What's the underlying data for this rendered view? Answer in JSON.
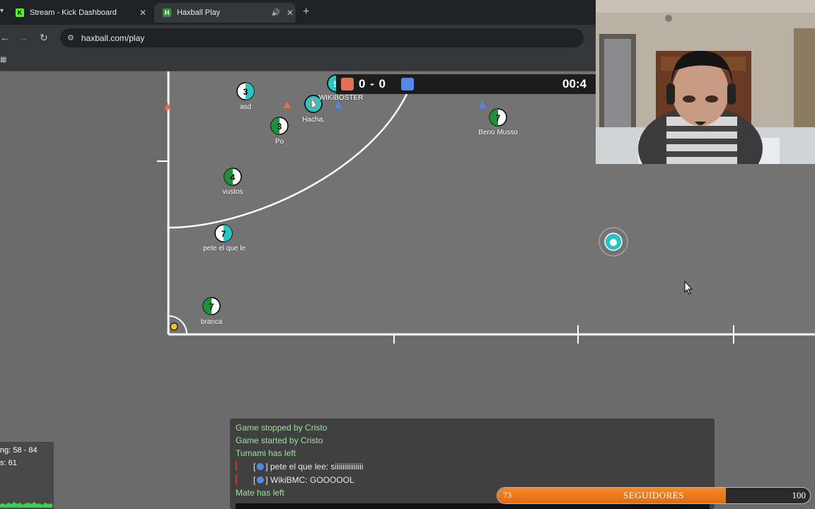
{
  "browser": {
    "tabs": [
      {
        "title": "Stream - Kick Dashboard",
        "icon": "kick-icon",
        "color": "#53fc18"
      },
      {
        "title": "Haxball Play",
        "icon": "haxball-icon",
        "color": "#3a8f3a"
      }
    ],
    "url": "haxball.com/play"
  },
  "scoreboard": {
    "score": "0 - 0",
    "time": "00:4",
    "red_color": "#e56e56",
    "blue_color": "#5689e5"
  },
  "players": [
    {
      "number": "3",
      "name": "asd"
    },
    {
      "number": "3",
      "name": "Po"
    },
    {
      "number": "",
      "name": "Hacha."
    },
    {
      "number": "5",
      "name": "WIKIBOSTER"
    },
    {
      "number": "7",
      "name": "Beno Musso"
    },
    {
      "number": "4",
      "name": "vustos"
    },
    {
      "number": "7",
      "name": "pete el que le"
    },
    {
      "number": "7",
      "name": "branca"
    }
  ],
  "chat": [
    {
      "type": "system",
      "text": "Game stopped by Cristo"
    },
    {
      "type": "system",
      "text": "Game started by Cristo"
    },
    {
      "type": "system",
      "text": "Tumami has left"
    },
    {
      "type": "player",
      "prefix": "[",
      "suffix": "] pete el que lee: siiiiiiiiiiiiiii"
    },
    {
      "type": "player",
      "prefix": "[",
      "suffix": "] WikiBMC: GOOOOOL"
    },
    {
      "type": "system",
      "text": "Mate has left"
    }
  ],
  "stats": {
    "ping": "ng: 58 - 84",
    "fps": "s: 61"
  },
  "followers": {
    "current": "73",
    "label": "SEGUIDORES",
    "goal": "100",
    "progress": 0.73
  }
}
